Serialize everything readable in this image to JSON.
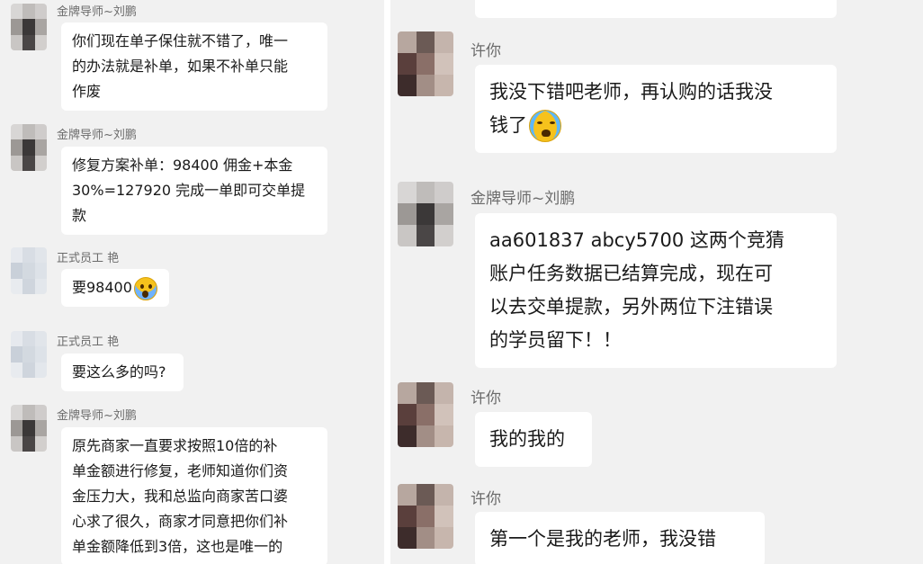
{
  "left_messages": [
    {
      "sender": "金牌导师~刘鹏",
      "lines": [
        "你们现在单子保住就不错了，唯一",
        "的办法就是补单，如果不补单只能",
        "作废"
      ],
      "avatar": "dark"
    },
    {
      "sender": "金牌导师~刘鹏",
      "lines": [
        "修复方案补单：98400  佣金+本金",
        "30%=127920 完成一单即可交单提",
        "款"
      ],
      "avatar": "dark"
    },
    {
      "sender": "正式员工  艳",
      "lines": [
        "要98400"
      ],
      "emoji": "face-screaming-in-fear",
      "avatar": "light"
    },
    {
      "sender": "正式员工  艳",
      "lines": [
        "要这么多的吗?"
      ],
      "avatar": "light"
    },
    {
      "sender": "金牌导师~刘鹏",
      "lines": [
        "原先商家一直要求按照10倍的补",
        "单金额进行修复，老师知道你们资",
        "金压力大，我和总监向商家苦口婆",
        "心求了很久，商家才同意把你们补",
        "单金额降低到3倍，这也是唯一的"
      ],
      "avatar": "dark"
    }
  ],
  "right_messages": [
    {
      "sender": "许你",
      "lines": [
        "我没下错吧老师，再认购的话我没",
        "钱了"
      ],
      "emoji": "loudly-crying-face",
      "avatar": "brown"
    },
    {
      "sender": "金牌导师~刘鹏",
      "lines": [
        "aa601837  abcy5700  这两个竞猜",
        "账户任务数据已结算完成，现在可",
        "以去交单提款，另外两位下注错误",
        "的学员留下！！"
      ],
      "avatar": "dark"
    },
    {
      "sender": "许你",
      "lines": [
        "我的我的"
      ],
      "avatar": "brown"
    },
    {
      "sender": "许你",
      "lines": [
        "第一个是我的老师，我没错"
      ],
      "avatar": "brown"
    }
  ]
}
